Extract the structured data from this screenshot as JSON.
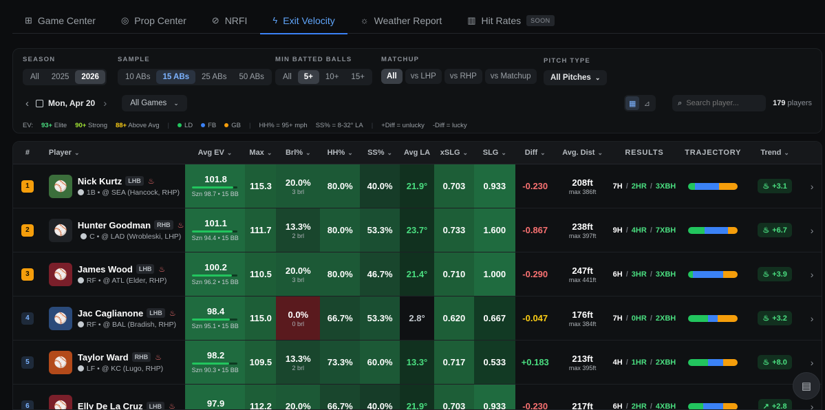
{
  "nav": {
    "tabs": [
      {
        "label": "Game Center",
        "icon": "gamepad-icon"
      },
      {
        "label": "Prop Center",
        "icon": "target-icon"
      },
      {
        "label": "NRFI",
        "icon": "no-sign-icon"
      },
      {
        "label": "Exit Velocity",
        "icon": "bolt-icon"
      },
      {
        "label": "Weather Report",
        "icon": "weather-icon"
      },
      {
        "label": "Hit Rates",
        "icon": "bar-chart-icon",
        "badge": "SOON"
      }
    ],
    "active": "Exit Velocity"
  },
  "filters": {
    "season": {
      "label": "SEASON",
      "options": [
        "All",
        "2025",
        "2026"
      ],
      "selected": "2026"
    },
    "sample": {
      "label": "SAMPLE",
      "options": [
        "10 ABs",
        "15 ABs",
        "25 ABs",
        "50 ABs"
      ],
      "selected": "15 ABs"
    },
    "min_batted": {
      "label": "MIN BATTED BALLS",
      "options": [
        "All",
        "5+",
        "10+",
        "15+"
      ],
      "selected": "5+"
    },
    "matchup": {
      "label": "MATCHUP",
      "options": [
        "All",
        "vs LHP",
        "vs RHP",
        "vs Matchup"
      ],
      "selected": "All"
    },
    "pitch_type": {
      "label": "PITCH TYPE",
      "value": "All Pitches"
    },
    "date": "Mon, Apr 20",
    "games": "All Games",
    "search_placeholder": "Search player...",
    "player_count": "179",
    "player_count_suffix": "players"
  },
  "legend": {
    "ev_label": "EV:",
    "tiers": [
      {
        "value": "93+",
        "text": "Elite",
        "color": "#4ade80"
      },
      {
        "value": "90+",
        "text": "Strong",
        "color": "#a3e635"
      },
      {
        "value": "88+",
        "text": "Above Avg",
        "color": "#facc15"
      }
    ],
    "types": [
      {
        "label": "LD",
        "color": "#22c55e"
      },
      {
        "label": "FB",
        "color": "#3b82f6"
      },
      {
        "label": "GB",
        "color": "#f59e0b"
      }
    ],
    "hh_def": "HH% = 95+ mph",
    "ss_def": "SS% = 8-32° LA",
    "plus_diff": "+Diff = unlucky",
    "minus_diff": "-Diff = lucky"
  },
  "table": {
    "headers": [
      "#",
      "Player",
      "Avg EV",
      "Max",
      "Brl%",
      "HH%",
      "SS%",
      "Avg LA",
      "xSLG",
      "SLG",
      "Diff",
      "Avg. Dist",
      "RESULTS",
      "TRAJECTORY",
      "Trend"
    ],
    "rows": [
      {
        "rank": "1",
        "name": "Nick Kurtz",
        "hand": "LHB",
        "pos": "1B",
        "opp": "@ SEA (Hancock, RHP)",
        "avg_ev": "101.8",
        "ev_fill": 0.92,
        "ev_sub": "Szn 98.7 • 15 BB",
        "max": "115.3",
        "brl": "20.0%",
        "brl_sub": "3 brl",
        "hh": "80.0%",
        "ss": "40.0%",
        "la": "21.9°",
        "xslg": "0.703",
        "slg": "0.933",
        "diff": "-0.230",
        "dist": "208ft",
        "max_dist": "max 386ft",
        "h": "7H",
        "hr": "2HR",
        "xbh": "3XBH",
        "traj": [
          0.14,
          0.48,
          0.38
        ],
        "trend": "+3.1"
      },
      {
        "rank": "2",
        "name": "Hunter Goodman",
        "hand": "RHB",
        "pos": "C",
        "opp": "@ LAD (Wrobleski, LHP)",
        "avg_ev": "101.1",
        "ev_fill": 0.9,
        "ev_sub": "Szn 94.4 • 15 BB",
        "max": "111.7",
        "brl": "13.3%",
        "brl_sub": "2 brl",
        "hh": "80.0%",
        "ss": "53.3%",
        "la": "23.7°",
        "xslg": "0.733",
        "slg": "1.600",
        "diff": "-0.867",
        "dist": "238ft",
        "max_dist": "max 397ft",
        "h": "9H",
        "hr": "4HR",
        "xbh": "7XBH",
        "traj": [
          0.33,
          0.47,
          0.2
        ],
        "trend": "+6.7"
      },
      {
        "rank": "3",
        "name": "James Wood",
        "hand": "LHB",
        "pos": "RF",
        "opp": "@ ATL (Elder, RHP)",
        "avg_ev": "100.2",
        "ev_fill": 0.88,
        "ev_sub": "Szn 96.2 • 15 BB",
        "max": "110.5",
        "brl": "20.0%",
        "brl_sub": "3 brl",
        "hh": "80.0%",
        "ss": "46.7%",
        "la": "21.4°",
        "xslg": "0.710",
        "slg": "1.000",
        "diff": "-0.290",
        "dist": "247ft",
        "max_dist": "max 441ft",
        "h": "6H",
        "hr": "3HR",
        "xbh": "3XBH",
        "traj": [
          0.1,
          0.6,
          0.3
        ],
        "trend": "+3.9"
      },
      {
        "rank": "4",
        "name": "Jac Caglianone",
        "hand": "LHB",
        "pos": "RF",
        "opp": "@ BAL (Bradish, RHP)",
        "avg_ev": "98.4",
        "ev_fill": 0.84,
        "ev_sub": "Szn 95.1 • 15 BB",
        "max": "115.0",
        "brl": "0.0%",
        "brl_sub": "0 brl",
        "hh": "66.7%",
        "ss": "53.3%",
        "la": "2.8°",
        "xslg": "0.620",
        "slg": "0.667",
        "diff": "-0.047",
        "dist": "176ft",
        "max_dist": "max 384ft",
        "h": "7H",
        "hr": "0HR",
        "xbh": "2XBH",
        "traj": [
          0.4,
          0.2,
          0.4
        ],
        "trend": "+3.2"
      },
      {
        "rank": "5",
        "name": "Taylor Ward",
        "hand": "RHB",
        "pos": "LF",
        "opp": "@ KC (Lugo, RHP)",
        "avg_ev": "98.2",
        "ev_fill": 0.83,
        "ev_sub": "Szn 90.3 • 15 BB",
        "max": "109.5",
        "brl": "13.3%",
        "brl_sub": "2 brl",
        "hh": "73.3%",
        "ss": "60.0%",
        "la": "13.3°",
        "xslg": "0.717",
        "slg": "0.533",
        "diff": "+0.183",
        "dist": "213ft",
        "max_dist": "max 395ft",
        "h": "4H",
        "hr": "1HR",
        "xbh": "2XBH",
        "traj": [
          0.4,
          0.3,
          0.3
        ],
        "trend": "+8.0"
      },
      {
        "rank": "6",
        "name": "Elly De La Cruz",
        "hand": "LHB",
        "pos": "",
        "opp": "",
        "avg_ev": "97.9",
        "ev_fill": 0.82,
        "ev_sub": "",
        "max": "112.2",
        "brl": "20.0%",
        "brl_sub": "",
        "hh": "66.7%",
        "ss": "40.0%",
        "la": "21.9°",
        "xslg": "0.703",
        "slg": "0.933",
        "diff": "-0.230",
        "dist": "217ft",
        "max_dist": "",
        "h": "6H",
        "hr": "2HR",
        "xbh": "4XBH",
        "traj": [
          0.3,
          0.4,
          0.3
        ],
        "trend": "+2.8"
      }
    ]
  }
}
